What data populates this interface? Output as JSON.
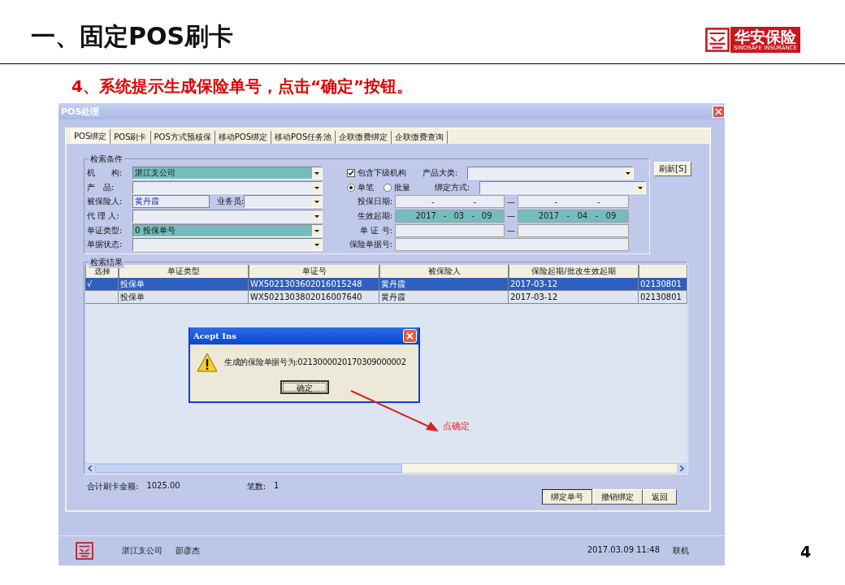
{
  "slide": {
    "title": "一、固定POS刷卡",
    "logo_text": "华安保险",
    "logo_subtext": "SINOSAFE INSURANCE",
    "subtitle": "4、系统提示生成保险单号，点击“确定”按钮。",
    "page_number": "4"
  },
  "window": {
    "title": "POS处理"
  },
  "tabs": [
    {
      "label": "POS绑定",
      "selected": true
    },
    {
      "label": "POS刷卡",
      "selected": false
    },
    {
      "label": "POS方式预核保",
      "selected": false
    },
    {
      "label": "移动POS绑定",
      "selected": false
    },
    {
      "label": "移动POS任务池",
      "selected": false
    },
    {
      "label": "企联缴费绑定",
      "selected": false
    },
    {
      "label": "企联缴费查询",
      "selected": false
    }
  ],
  "search": {
    "title": "检索条件",
    "refresh_button": "刷新[S]",
    "left": [
      {
        "kind": "combo",
        "label": "机　　构:",
        "value": "湛江支公司",
        "highlighted": true
      },
      {
        "kind": "combo",
        "label": "产　品:",
        "highlighted": false
      },
      {
        "kind": "person",
        "label": "被保险人:",
        "value": "黄丹霞",
        "second_label": "业务员:"
      },
      {
        "kind": "combo",
        "label": "代 理 人:",
        "highlighted": false
      },
      {
        "kind": "combo",
        "label": "单证类型:",
        "value": "0 投保单号",
        "highlighted": true
      },
      {
        "kind": "combo",
        "label": "单据状态:",
        "highlighted": false
      }
    ],
    "right": [
      {
        "kind": "check_combo",
        "check": {
          "label": "包含下级机构",
          "checked": true
        },
        "label": "产品大类:"
      },
      {
        "kind": "radio_combo",
        "options": [
          {
            "label": "单笔",
            "selected": true
          },
          {
            "label": "批量",
            "selected": false
          }
        ],
        "label": "绑定方式:"
      },
      {
        "kind": "range",
        "label": "投保日期:",
        "highlighted": false,
        "start": [
          "-",
          "-"
        ],
        "separator": "—",
        "end": [
          "-",
          "-"
        ]
      },
      {
        "kind": "range",
        "label": "生效起期:",
        "highlighted": true,
        "start": [
          "2017",
          "-",
          "03",
          "-",
          "09"
        ],
        "separator": "—",
        "end": [
          "2017",
          "-",
          "04",
          "-",
          "09"
        ]
      },
      {
        "kind": "range",
        "label": "单 证 号:",
        "highlighted": false,
        "separator": "—"
      },
      {
        "kind": "single",
        "label": "保险单据号:"
      }
    ]
  },
  "results": {
    "title": "检索结果",
    "columns": [
      {
        "label": "选择"
      },
      {
        "label": "单证类型"
      },
      {
        "label": "单证号"
      },
      {
        "label": "被保险人"
      },
      {
        "label": "保险起期/批改生效起期"
      },
      {}
    ],
    "rows": [
      {
        "selected": true,
        "cells": [
          "√",
          "投保单",
          "WX5021303602016015248",
          "黄丹霞",
          "2017-03-12",
          "02130801"
        ]
      },
      {
        "selected": false,
        "cells": [
          "",
          "投保单",
          "WX5021303802016007640",
          "黄丹霞",
          "2017-03-12",
          "02130801"
        ]
      }
    ]
  },
  "totals": [
    {
      "label": "合计刷卡金额:",
      "value": "1025.00"
    },
    {
      "label": "笔数:",
      "value": "1"
    }
  ],
  "buttons": [
    {
      "label": "绑定单号",
      "default": true
    },
    {
      "label": "撤销绑定",
      "default": false
    },
    {
      "label": "返回",
      "default": false
    }
  ],
  "status_bar": {
    "items": [
      "湛江支公司",
      "邵彦杰"
    ],
    "right_items": [
      "2017.03.09 11:48",
      "联机"
    ]
  },
  "dialog": {
    "title": "Acept Ins",
    "message": "生成的保险单据号为:0213000020170309000002",
    "button": "确定"
  },
  "annotation": {
    "text": "点确定"
  }
}
